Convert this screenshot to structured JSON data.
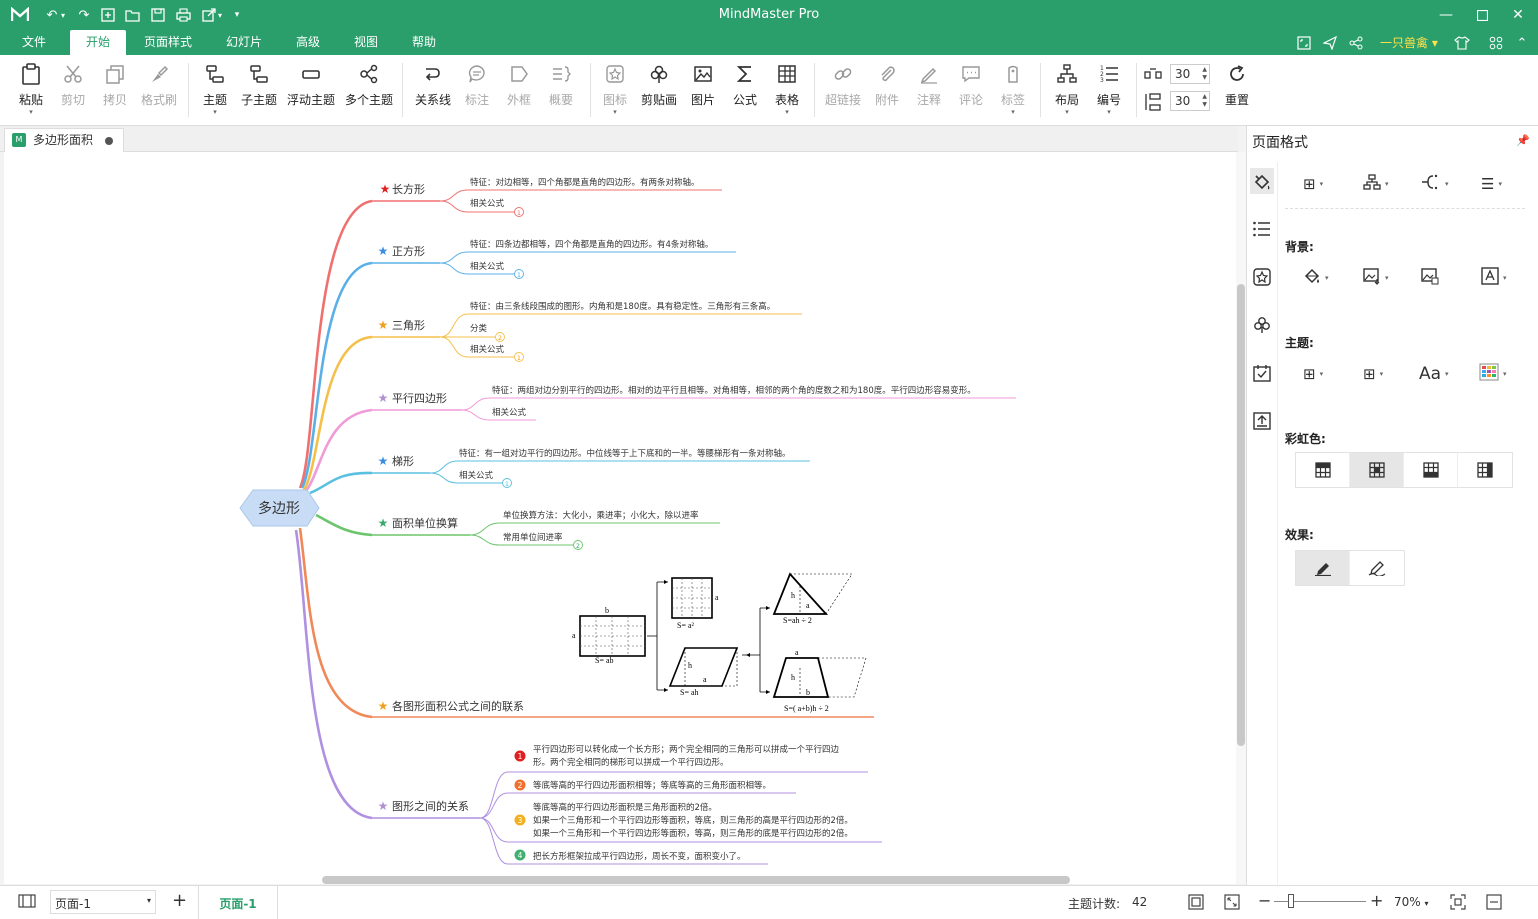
{
  "window": {
    "title": "MindMaster Pro",
    "minimize_icon": "minimize-icon",
    "maximize_icon": "maximize-icon",
    "close_icon": "close-icon"
  },
  "menu": {
    "tabs": [
      "文件",
      "开始",
      "页面样式",
      "幻灯片",
      "高级",
      "视图",
      "帮助"
    ],
    "active": "开始",
    "user": "一只兽禽"
  },
  "ribbon": {
    "paste": "粘贴",
    "cut": "剪切",
    "copy": "拷贝",
    "format_painter": "格式刷",
    "topic": "主题",
    "subtopic": "子主题",
    "floating_topic": "浮动主题",
    "multi_topic": "多个主题",
    "relationship": "关系线",
    "callout": "标注",
    "boundary": "外框",
    "summary": "概要",
    "icon": "图标",
    "clipart": "剪贴画",
    "image": "图片",
    "formula": "公式",
    "table": "表格",
    "hyperlink": "超链接",
    "attachment": "附件",
    "note": "注释",
    "comment": "评论",
    "tag": "标签",
    "layout": "布局",
    "numbering": "编号",
    "spacing_h": "30",
    "spacing_v": "30",
    "reset": "重置"
  },
  "document": {
    "tab_name": "多边形面积"
  },
  "mindmap": {
    "root": "多边形",
    "branches": [
      {
        "label": "长方形",
        "color": "#f07070",
        "star": "#e02020",
        "children": [
          "特征：对边相等，四个角都是直角的四边形。有两条对称轴。",
          "相关公式"
        ],
        "badges": [
          "1"
        ]
      },
      {
        "label": "正方形",
        "color": "#5ab0e6",
        "star": "#3a8de0",
        "children": [
          "特征：四条边都相等，四个角都是直角的四边形。有4条对称轴。",
          "相关公式"
        ],
        "badges": [
          "1"
        ]
      },
      {
        "label": "三角形",
        "color": "#f5c04a",
        "star": "#f0a020",
        "children": [
          "特征：由三条线段围成的图形。内角和是180度。具有稳定性。三角形有三条高。",
          "分类",
          "相关公式"
        ],
        "badges": [
          "2",
          "1"
        ]
      },
      {
        "label": "平行四边形",
        "color": "#f09ad8",
        "star": "#b090d0",
        "children": [
          "特征：两组对边分别平行的四边形。相对的边平行且相等。对角相等，相邻的两个角的度数之和为180度。平行四边形容易变形。",
          "相关公式"
        ],
        "badges": []
      },
      {
        "label": "梯形",
        "color": "#5ac0e0",
        "star": "#3a8de0",
        "children": [
          "特征：有一组对边平行的四边形。中位线等于上下底和的一半。等腰梯形有一条对称轴。",
          "相关公式"
        ],
        "badges": [
          "1"
        ]
      },
      {
        "label": "面积单位换算",
        "color": "#6cc56c",
        "star": "#3aaa6a",
        "children": [
          "单位换算方法：大化小，乘进率；小化大，除以进率",
          "常用单位间进率"
        ],
        "badges": [
          "2"
        ]
      },
      {
        "label": "各图形面积公式之间的联系",
        "color": "#f08858",
        "star": "#f0a020",
        "children": [],
        "badges": []
      },
      {
        "label": "图形之间的关系",
        "color": "#b090e0",
        "star": "#b090d0",
        "numbered": [
          {
            "n": "1",
            "color": "#e02020",
            "lines": [
              "平行四边形可以转化成一个长方形；两个完全相同的三角形可以拼成一个平行四边",
              "形。两个完全相同的梯形可以拼成一个平行四边形。"
            ]
          },
          {
            "n": "2",
            "color": "#f07030",
            "lines": [
              "等底等高的平行四边形面积相等；等底等高的三角形面积相等。"
            ]
          },
          {
            "n": "3",
            "color": "#f0b020",
            "lines": [
              "等底等高的平行四边形面积是三角形面积的2倍。",
              "如果一个三角形和一个平行四边形等面积，等底，则三角形的高是平行四边形的2倍。",
              "如果一个三角形和一个平行四边形等面积，等高，则三角形的底是平行四边形的2倍。"
            ]
          },
          {
            "n": "4",
            "color": "#40b070",
            "lines": [
              "把长方形框架拉成平行四边形，周长不变，面积变小了。"
            ]
          }
        ]
      }
    ],
    "diagram_labels": {
      "rect_b": "b",
      "rect_a": "a",
      "rect_formula": "S= ab",
      "square_a": "a",
      "square_formula": "S= a²",
      "para_h": "h",
      "para_a": "a",
      "para_formula": "S= ah",
      "tri_h": "h",
      "tri_a": "a",
      "tri_formula": "S=ah ÷ 2",
      "trap_a": "a",
      "trap_h": "h",
      "trap_b": "b",
      "trap_formula": "S=( a+b)h ÷ 2"
    }
  },
  "panel": {
    "title": "页面格式",
    "background": "背景:",
    "theme": "主题:",
    "rainbow": "彩虹色:",
    "effect": "效果:",
    "font_label": "Aa"
  },
  "status": {
    "page_select": "页面-1",
    "page_tab": "页面-1",
    "topic_count_label": "主题计数:",
    "topic_count": "42",
    "zoom": "70%"
  }
}
